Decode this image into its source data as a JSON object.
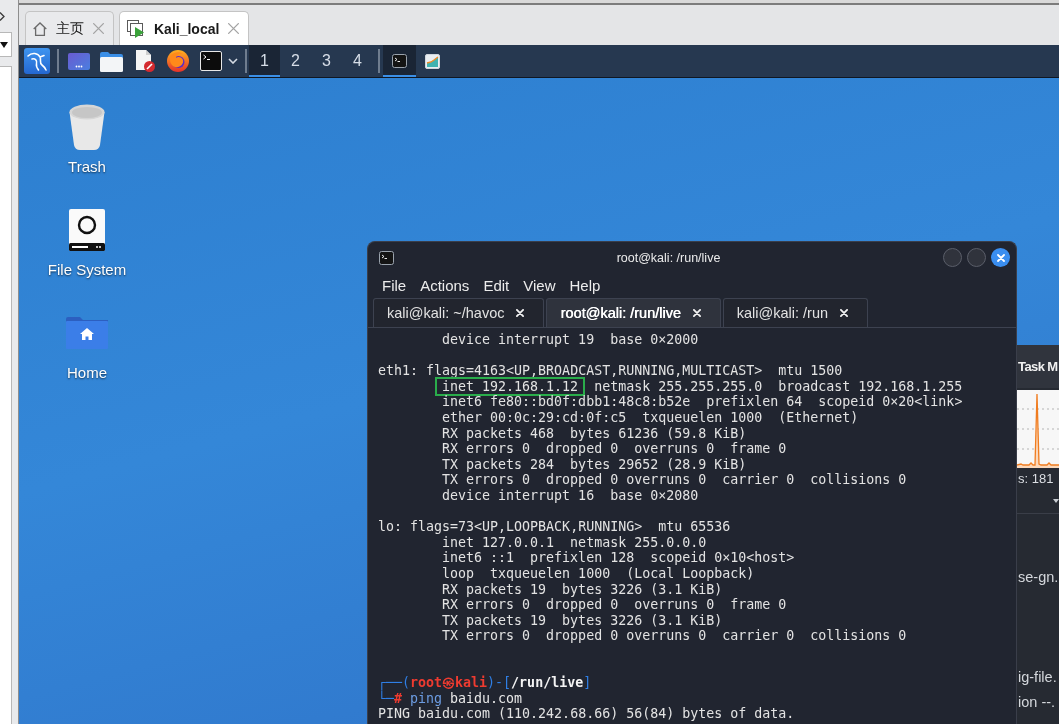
{
  "tabs": [
    {
      "label": "主页",
      "kind": "home",
      "selected": false
    },
    {
      "label": "Kali_local",
      "kind": "vm",
      "selected": true
    }
  ],
  "panel": {
    "workspaces": [
      {
        "label": "1",
        "selected": true
      },
      {
        "label": "2",
        "selected": false
      },
      {
        "label": "3",
        "selected": false
      },
      {
        "label": "4",
        "selected": false
      }
    ],
    "tasks": [
      {
        "kind": "terminal",
        "selected": true
      },
      {
        "kind": "monitor",
        "selected": false
      }
    ]
  },
  "desktop_icons": [
    {
      "label": "Trash",
      "kind": "trash"
    },
    {
      "label": "File System",
      "kind": "drive"
    },
    {
      "label": "Home",
      "kind": "home"
    }
  ],
  "terminal": {
    "title": "root@kali: /run/live",
    "menu": [
      "File",
      "Actions",
      "Edit",
      "View",
      "Help"
    ],
    "tabs": [
      {
        "label": "kali@kali: ~/havoc",
        "selected": false
      },
      {
        "label": "root@kali: /run/live",
        "selected": true
      },
      {
        "label": "kali@kali: /run",
        "selected": false
      }
    ],
    "lines": [
      {
        "kind": "detail",
        "text": "device interrupt 19  base 0×2000"
      },
      {
        "kind": "blank"
      },
      {
        "kind": "head",
        "text": "eth1: flags=4163<UP,BROADCAST,RUNNING,MULTICAST>  mtu 1500"
      },
      {
        "kind": "marked",
        "text": "inet 192.168.1.12",
        "rest": "netmask 255.255.255.0  broadcast 192.168.1.255"
      },
      {
        "kind": "detail",
        "text": "inet6 fe80::bd0f:dbb1:48c8:b52e  prefixlen 64  scopeid 0×20<link>"
      },
      {
        "kind": "detail",
        "text": "ether 00:0c:29:cd:0f:c5  txqueuelen 1000  (Ethernet)"
      },
      {
        "kind": "detail",
        "text": "RX packets 468  bytes 61236 (59.8 KiB)"
      },
      {
        "kind": "detail",
        "text": "RX errors 0  dropped 0  overruns 0  frame 0"
      },
      {
        "kind": "detail",
        "text": "TX packets 284  bytes 29652 (28.9 KiB)"
      },
      {
        "kind": "detail",
        "text": "TX errors 0  dropped 0 overruns 0  carrier 0  collisions 0"
      },
      {
        "kind": "detail",
        "text": "device interrupt 16  base 0×2080"
      },
      {
        "kind": "blank"
      },
      {
        "kind": "head",
        "text": "lo: flags=73<UP,LOOPBACK,RUNNING>  mtu 65536"
      },
      {
        "kind": "detail",
        "text": "inet 127.0.0.1  netmask 255.0.0.0"
      },
      {
        "kind": "detail",
        "text": "inet6 ::1  prefixlen 128  scopeid 0×10<host>"
      },
      {
        "kind": "detail",
        "text": "loop  txqueuelen 1000  (Local Loopback)"
      },
      {
        "kind": "detail",
        "text": "RX packets 19  bytes 3226 (3.1 KiB)"
      },
      {
        "kind": "detail",
        "text": "RX errors 0  dropped 0  overruns 0  frame 0"
      },
      {
        "kind": "detail",
        "text": "TX packets 19  bytes 3226 (3.1 KiB)"
      },
      {
        "kind": "detail",
        "text": "TX errors 0  dropped 0 overruns 0  carrier 0  collisions 0"
      },
      {
        "kind": "blank"
      },
      {
        "kind": "blank"
      },
      {
        "kind": "prompt",
        "segments": [
          {
            "text": "┌──(",
            "kind": "frame"
          },
          {
            "text": "root㉿kali",
            "kind": "user"
          },
          {
            "text": ")-[",
            "kind": "frame"
          },
          {
            "text": "/run/live",
            "kind": "path"
          },
          {
            "text": "]",
            "kind": "frame"
          }
        ]
      },
      {
        "kind": "command",
        "segments": [
          {
            "text": "└─",
            "kind": "frame"
          },
          {
            "text": "#",
            "kind": "sign"
          },
          {
            "text": " ping",
            "kind": "command"
          },
          {
            "text": " baidu.com",
            "kind": "argument"
          }
        ]
      },
      {
        "kind": "head",
        "text": "PING baidu.com (110.242.68.66) 56(84) bytes of data."
      }
    ]
  },
  "task_manager": {
    "title": "Task M",
    "processes": "s: 181",
    "rows": [
      {
        "kind": "covered"
      },
      {
        "kind": "covered"
      },
      {
        "kind": "text",
        "text": "se-gn."
      },
      {
        "kind": "covered"
      },
      {
        "kind": "covered"
      },
      {
        "kind": "covered"
      },
      {
        "kind": "text",
        "text": "ig-file."
      },
      {
        "kind": "text",
        "text": "ion --."
      }
    ]
  }
}
